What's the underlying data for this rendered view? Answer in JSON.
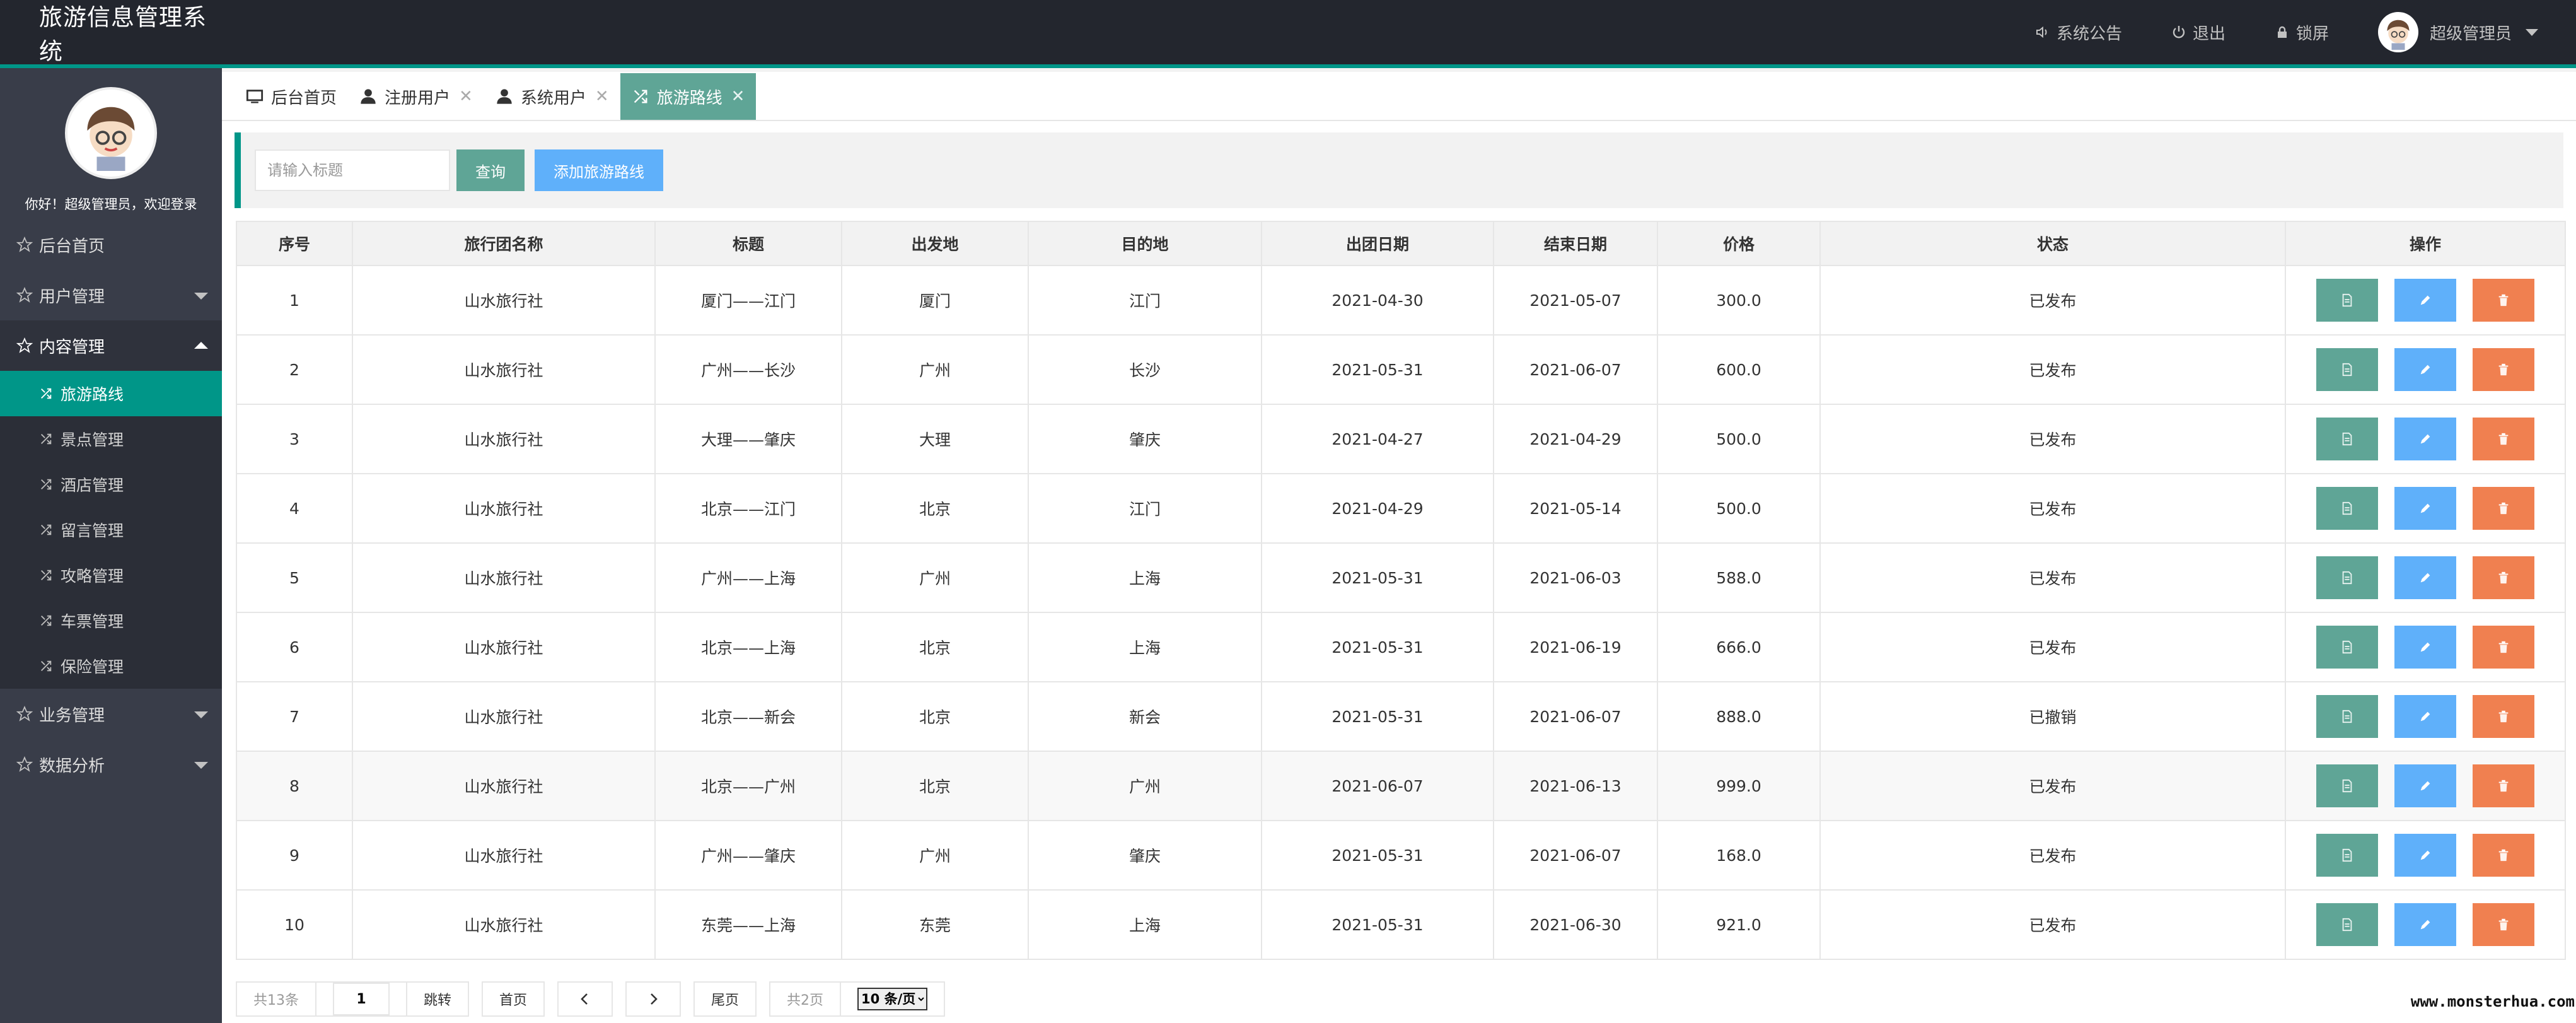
{
  "app": {
    "title": "旅游信息管理系统"
  },
  "header": {
    "notice": "系统公告",
    "logout": "退出",
    "lock": "锁屏",
    "user": "超级管理员"
  },
  "sidebar": {
    "welcome": "你好！超级管理员，欢迎登录",
    "menu": {
      "home": "后台首页",
      "users": "用户管理",
      "content": "内容管理",
      "business": "业务管理",
      "analytics": "数据分析"
    },
    "content_items": [
      "旅游路线",
      "景点管理",
      "酒店管理",
      "留言管理",
      "攻略管理",
      "车票管理",
      "保险管理"
    ]
  },
  "tabs": [
    "后台首页",
    "注册用户",
    "系统用户",
    "旅游路线"
  ],
  "toolbar": {
    "search_placeholder": "请输入标题",
    "query": "查询",
    "add": "添加旅游路线"
  },
  "table": {
    "columns": [
      "序号",
      "旅行团名称",
      "标题",
      "出发地",
      "目的地",
      "出团日期",
      "结束日期",
      "价格",
      "状态",
      "操作"
    ],
    "rows": [
      [
        "1",
        "山水旅行社",
        "厦门——江门",
        "厦门",
        "江门",
        "2021-04-30",
        "2021-05-07",
        "300.0",
        "已发布"
      ],
      [
        "2",
        "山水旅行社",
        "广州——长沙",
        "广州",
        "长沙",
        "2021-05-31",
        "2021-06-07",
        "600.0",
        "已发布"
      ],
      [
        "3",
        "山水旅行社",
        "大理——肇庆",
        "大理",
        "肇庆",
        "2021-04-27",
        "2021-04-29",
        "500.0",
        "已发布"
      ],
      [
        "4",
        "山水旅行社",
        "北京——江门",
        "北京",
        "江门",
        "2021-04-29",
        "2021-05-14",
        "500.0",
        "已发布"
      ],
      [
        "5",
        "山水旅行社",
        "广州——上海",
        "广州",
        "上海",
        "2021-05-31",
        "2021-06-03",
        "588.0",
        "已发布"
      ],
      [
        "6",
        "山水旅行社",
        "北京——上海",
        "北京",
        "上海",
        "2021-05-31",
        "2021-06-19",
        "666.0",
        "已发布"
      ],
      [
        "7",
        "山水旅行社",
        "北京——新会",
        "北京",
        "新会",
        "2021-05-31",
        "2021-06-07",
        "888.0",
        "已撤销"
      ],
      [
        "8",
        "山水旅行社",
        "北京——广州",
        "北京",
        "广州",
        "2021-06-07",
        "2021-06-13",
        "999.0",
        "已发布"
      ],
      [
        "9",
        "山水旅行社",
        "广州——肇庆",
        "广州",
        "肇庆",
        "2021-05-31",
        "2021-06-07",
        "168.0",
        "已发布"
      ],
      [
        "10",
        "山水旅行社",
        "东莞——上海",
        "东莞",
        "上海",
        "2021-05-31",
        "2021-06-30",
        "921.0",
        "已发布"
      ]
    ]
  },
  "pager": {
    "total": "共13条",
    "page": "1",
    "jump": "跳转",
    "first": "首页",
    "last": "尾页",
    "pages": "共2页",
    "size_option": "10 条/页"
  },
  "watermark": "www.monsterhua.com",
  "colors": {
    "accent": "#009688",
    "header_bg": "#23262e",
    "sidebar_bg": "#393d49",
    "edit": "#5fb0fa",
    "delete": "#f08050"
  },
  "icons": {
    "notice": "speaker-icon",
    "logout": "power-icon",
    "lock": "lock-icon",
    "menu": "star-icon",
    "route": "route-icon",
    "view": "document-icon",
    "edit": "pencil-icon",
    "delete": "trash-icon"
  }
}
